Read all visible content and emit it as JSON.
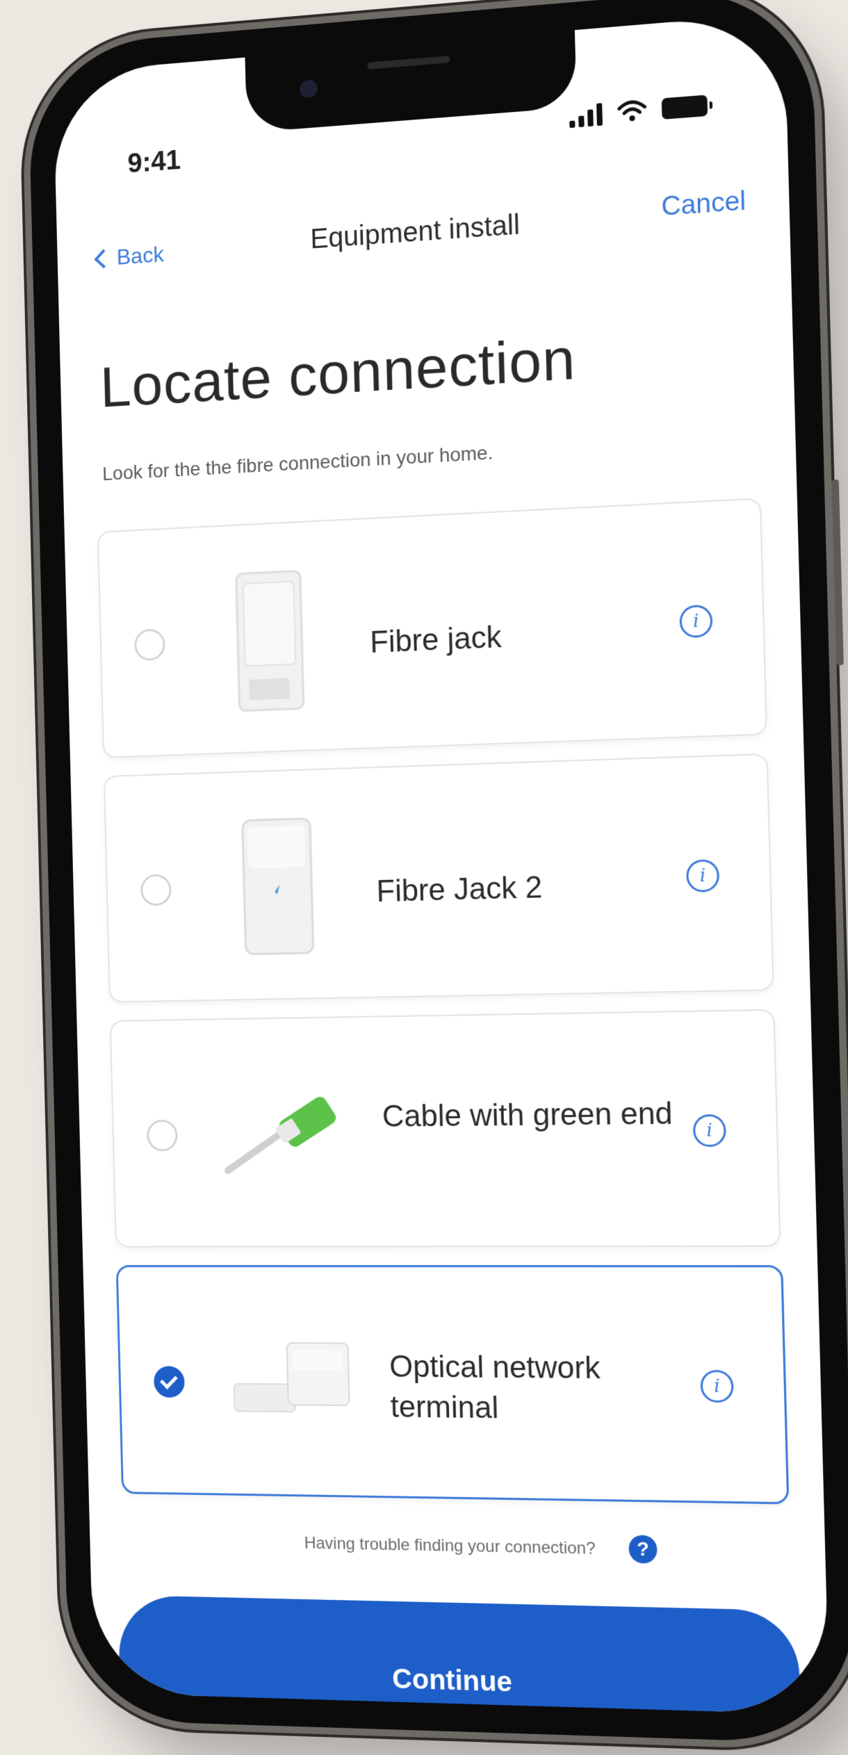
{
  "status_bar": {
    "time": "9:41"
  },
  "nav": {
    "back_label": "Back",
    "title": "Equipment install",
    "cancel_label": "Cancel"
  },
  "page": {
    "title": "Locate connection",
    "subtitle": "Look for the the fibre connection in your home."
  },
  "options": [
    {
      "label": "Fibre jack",
      "selected": false,
      "thumbnail": "fibre-jack-device"
    },
    {
      "label": "Fibre Jack 2",
      "selected": false,
      "thumbnail": "fibre-jack-2-device"
    },
    {
      "label": "Cable with green end",
      "selected": false,
      "thumbnail": "green-cable"
    },
    {
      "label": "Optical network terminal",
      "selected": true,
      "thumbnail": "ont-device"
    }
  ],
  "help": {
    "text": "Having trouble finding your connection?"
  },
  "continue_label": "Continue",
  "colors": {
    "accent": "#3d7bd9",
    "primary_button": "#1e5ec8",
    "background": "#ece8e2"
  }
}
